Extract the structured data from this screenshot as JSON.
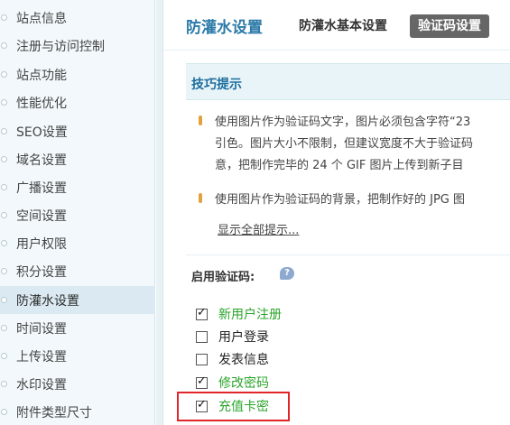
{
  "sidebar": {
    "items": [
      {
        "label": "站点信息"
      },
      {
        "label": "注册与访问控制"
      },
      {
        "label": "站点功能"
      },
      {
        "label": "性能优化"
      },
      {
        "label": "SEO设置"
      },
      {
        "label": "域名设置"
      },
      {
        "label": "广播设置"
      },
      {
        "label": "空间设置"
      },
      {
        "label": "用户权限"
      },
      {
        "label": "积分设置"
      },
      {
        "label": "防灌水设置",
        "active": true
      },
      {
        "label": "时间设置"
      },
      {
        "label": "上传设置"
      },
      {
        "label": "水印设置"
      },
      {
        "label": "附件类型尺寸"
      }
    ]
  },
  "header": {
    "title": "防灌水设置",
    "tabs": [
      {
        "label": "防灌水基本设置"
      },
      {
        "label": "验证码设置",
        "active": true
      }
    ]
  },
  "tips": {
    "title": "技巧提示",
    "lines": [
      "使用图片作为验证码文字，图片必须包含字符“23",
      "引色。图片大小不限制，但建议宽度不大于验证码",
      "意，把制作完毕的 24 个 GIF 图片上传到新子目",
      "使用图片作为验证码的背景，把制作好的 JPG 图"
    ],
    "show_all": "显示全部提示..."
  },
  "captcha": {
    "enable_label": "启用验证码:",
    "help_icon_text": "?",
    "options": [
      {
        "label": "新用户注册",
        "checked": true
      },
      {
        "label": "用户登录",
        "checked": false
      },
      {
        "label": "发表信息",
        "checked": false
      },
      {
        "label": "修改密码",
        "checked": true
      },
      {
        "label": "充值卡密",
        "checked": true
      }
    ]
  },
  "colors": {
    "accent": "#2b7aa8",
    "checked_label": "#2aa52a",
    "highlight": "#e0262b",
    "tab_active_bg": "#666666"
  }
}
